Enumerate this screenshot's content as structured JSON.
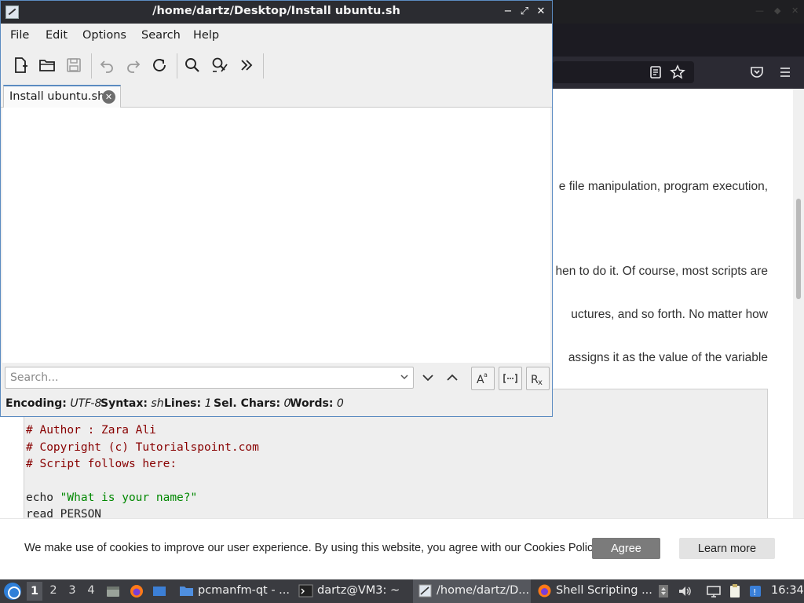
{
  "editor": {
    "title": "/home/dartz/Desktop/Install ubuntu.sh",
    "menu": [
      "File",
      "Edit",
      "Options",
      "Search",
      "Help"
    ],
    "tab_label": "Install ubuntu.sh",
    "search_placeholder": "Search...",
    "status": {
      "encoding_label": "Encoding:",
      "encoding_value": "UTF-8",
      "syntax_label": "Syntax:",
      "syntax_value": "sh",
      "lines_label": "Lines:",
      "lines_value": "1",
      "selchars_label": "Sel. Chars:",
      "selchars_value": "0",
      "words_label": "Words:",
      "words_value": "0"
    }
  },
  "browser": {
    "article_lines": [
      "e file manipulation, program execution,",
      "hen to do it. Of course, most scripts are",
      "uctures, and so forth. No matter how",
      "assigns it as the value of the variable"
    ],
    "code_lines": [
      {
        "type": "comment",
        "text": "# Author : Zara Ali"
      },
      {
        "type": "comment",
        "text": "# Copyright (c) Tutorialspoint.com"
      },
      {
        "type": "comment",
        "text": "# Script follows here:"
      },
      {
        "type": "blank",
        "text": ""
      },
      {
        "type": "echo",
        "cmd": "echo ",
        "str": "\"What is your name?\""
      },
      {
        "type": "plain",
        "text": "read PERSON"
      }
    ]
  },
  "cookie": {
    "message": "We make use of cookies to improve our user experience. By using this website, you agree with our Cookies Policy.",
    "agree_label": "Agree",
    "learn_label": "Learn more"
  },
  "taskbar": {
    "workspaces": [
      "1",
      "2",
      "3",
      "4"
    ],
    "tasks": [
      {
        "label": "pcmanfm-qt - ..."
      },
      {
        "label": "dartz@VM3: ~"
      },
      {
        "label": "/home/dartz/D..."
      },
      {
        "label": "Shell Scripting ..."
      }
    ],
    "clock": "16:34"
  },
  "colors": {
    "accent": "#5b8bc1",
    "titlebar": "#2b2c31",
    "taskbar": "#3a3b40",
    "code_comment": "#880000",
    "code_string": "#008800"
  }
}
